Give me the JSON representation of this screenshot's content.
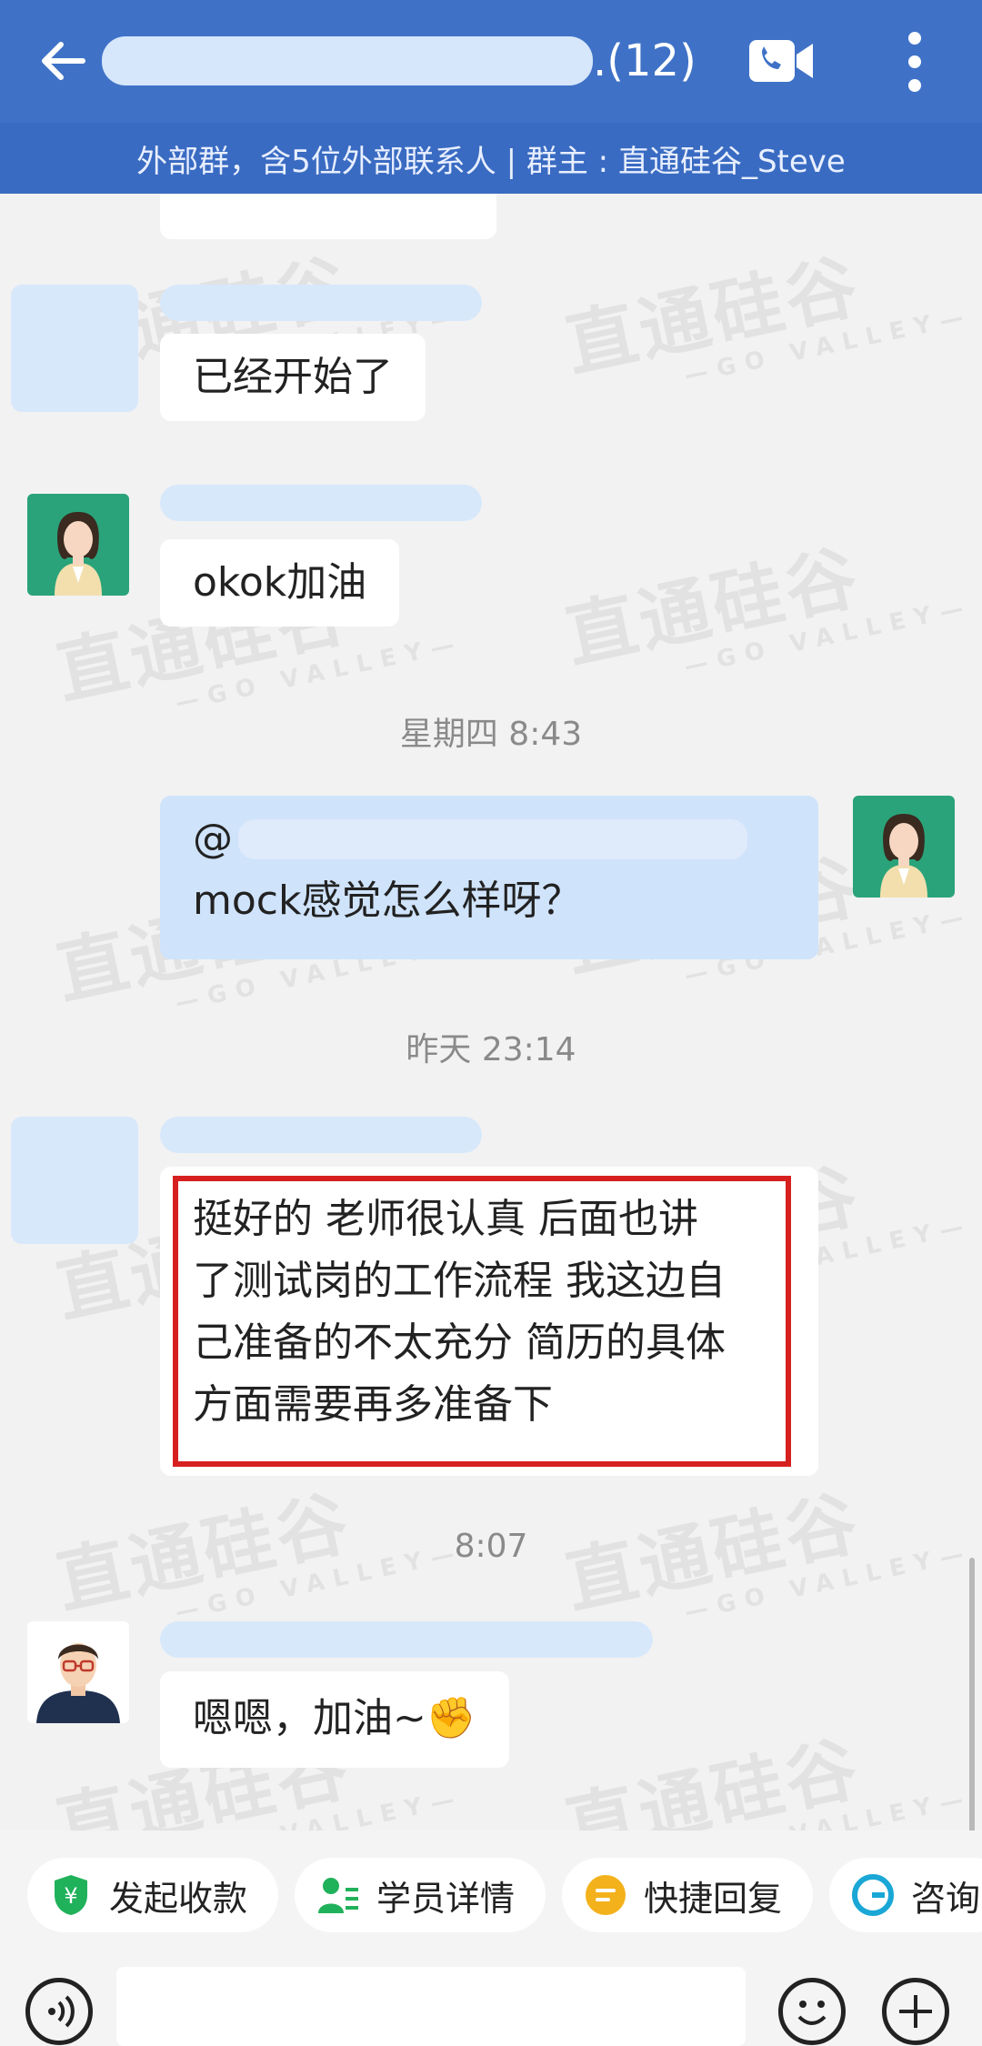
{
  "header": {
    "title_suffix": ".(12)",
    "external_info": "外部群，含5位外部联系人 | 群主 : 直通硅谷_Steve"
  },
  "watermark": {
    "brand": "直通硅谷",
    "sub": "—GO VALLEY—"
  },
  "messages": [
    {
      "sender": "other",
      "text": "已经开始了"
    },
    {
      "sender": "agent",
      "text": "okok加油"
    },
    {
      "sender": "me",
      "mention": "@",
      "text": "mock感觉怎么样呀？"
    },
    {
      "sender": "other",
      "lines": [
        "挺好的 老师很认真 后面也讲",
        "了测试岗的工作流程 我这边自",
        "己准备的不太充分 简历的具体",
        "方面需要再多准备下"
      ]
    },
    {
      "sender": "teacher",
      "text": "嗯嗯，加油~✊"
    }
  ],
  "timestamps": {
    "t1": "星期四 8:43",
    "t2": "昨天 23:14",
    "t3": "8:07"
  },
  "quick_actions": [
    {
      "label": "发起收款",
      "icon": "shield-yen-icon",
      "color": "#20b15b"
    },
    {
      "label": "学员详情",
      "icon": "user-card-icon",
      "color": "#20b15b"
    },
    {
      "label": "快捷回复",
      "icon": "quick-reply-icon",
      "color": "#f3b21b"
    },
    {
      "label": "咨询",
      "icon": "g-logo-icon",
      "color": "#1aa7d6"
    }
  ],
  "colors": {
    "header_bg": "#3f72c7",
    "my_bubble": "#cfe3fb",
    "highlight": "#d6201f"
  }
}
